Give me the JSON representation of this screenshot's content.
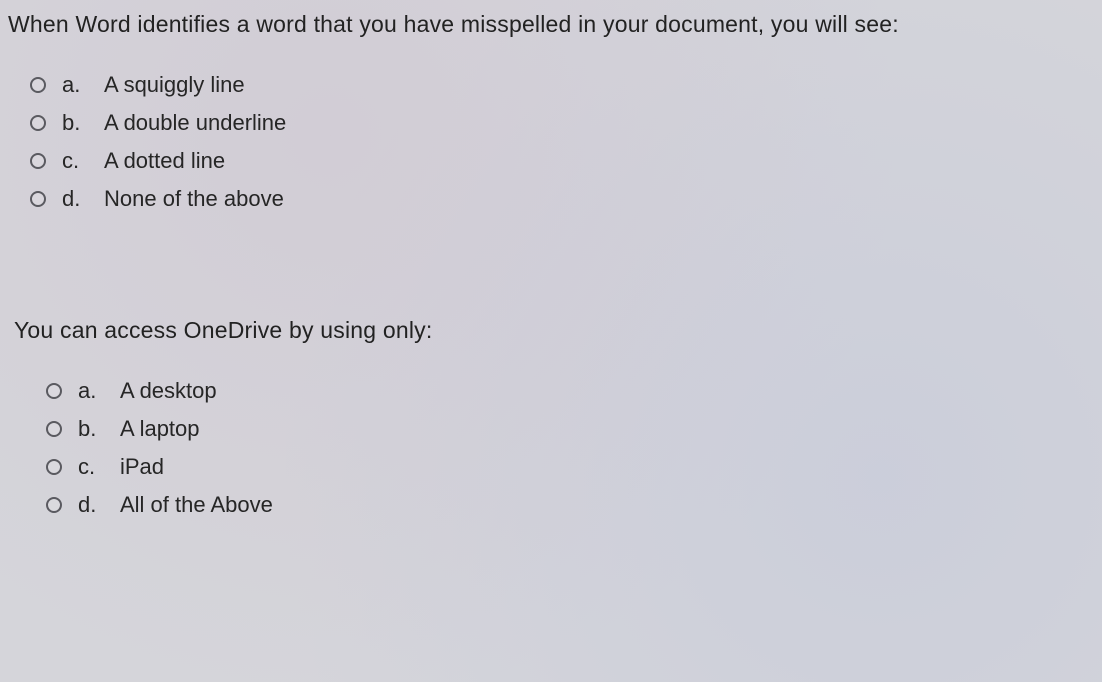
{
  "questions": [
    {
      "prompt": "When Word identifies a word that you have misspelled in your document, you will see:",
      "options": [
        {
          "letter": "a.",
          "text": "A squiggly line"
        },
        {
          "letter": "b.",
          "text": "A double underline"
        },
        {
          "letter": "c.",
          "text": "A dotted line"
        },
        {
          "letter": "d.",
          "text": "None of the above"
        }
      ]
    },
    {
      "prompt": "You can access OneDrive by using only:",
      "options": [
        {
          "letter": "a.",
          "text": "A desktop"
        },
        {
          "letter": "b.",
          "text": "A laptop"
        },
        {
          "letter": "c.",
          "text": "iPad"
        },
        {
          "letter": "d.",
          "text": "All of the Above"
        }
      ]
    }
  ]
}
